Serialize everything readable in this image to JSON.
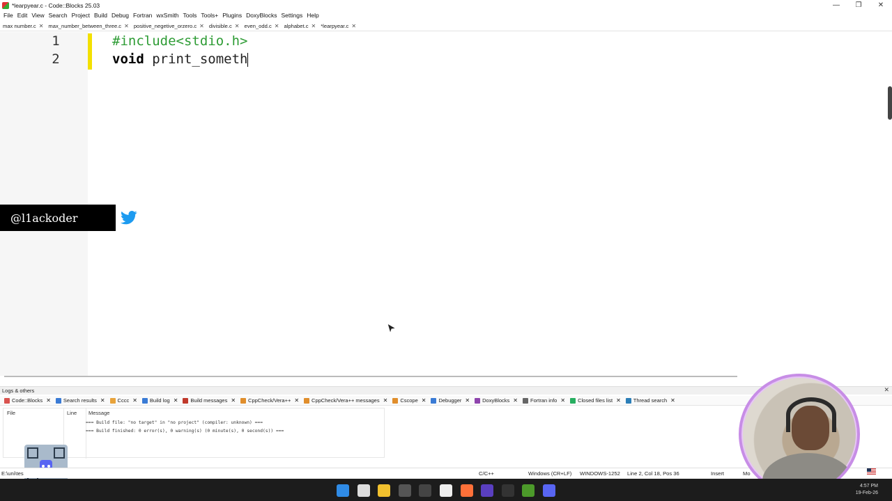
{
  "window": {
    "title": "*learpyear.c - Code::Blocks 25.03",
    "controls": [
      "—",
      "❐",
      "✕"
    ]
  },
  "menu": [
    "File",
    "Edit",
    "View",
    "Search",
    "Project",
    "Build",
    "Debug",
    "Fortran",
    "wxSmith",
    "Tools",
    "Tools+",
    "Plugins",
    "DoxyBlocks",
    "Settings",
    "Help"
  ],
  "tabs": [
    "max number.c",
    "max_number_between_three.c",
    "positive_negetive_orzero.c",
    "divisible.c",
    "even_odd.c",
    "alphabet.c",
    "*learpyear.c"
  ],
  "editor": {
    "line_numbers": [
      "1",
      "2"
    ],
    "line1": "#include<stdio.h>",
    "line2_kw": "void",
    "line2_rest": " print_someth"
  },
  "overlay": {
    "handle": "@l1ackoder",
    "icon": "twitter-bird"
  },
  "logs": {
    "title": "Logs & others",
    "tabs": [
      "Code::Blocks",
      "Search results",
      "Cccc",
      "Build log",
      "Build messages",
      "CppCheck/Vera++",
      "CppCheck/Vera++ messages",
      "Cscope",
      "Debugger",
      "DoxyBlocks",
      "Fortran info",
      "Closed files list",
      "Thread search"
    ],
    "tab_colors": [
      "#d9534f",
      "#3a7bd5",
      "#e8a33b",
      "#3a7bd5",
      "#c0392b",
      "#e08e2c",
      "#e08e2c",
      "#e08e2c",
      "#3a7bd5",
      "#8e44ad",
      "#666666",
      "#27ae60",
      "#2c7fb8"
    ],
    "columns": [
      "File",
      "Line",
      "Message"
    ],
    "messages": [
      "=== Build file: \"no target\" in \"no project\" (compiler: unknown) ===",
      "=== Build finished: 0 error(s), 0 warning(s) (0 minute(s), 0 second(s)) ==="
    ]
  },
  "status": {
    "path": "E:\\uni\\tes",
    "lang": "C/C++",
    "eol": "Windows (CR+LF)",
    "encoding": "WINDOWS-1252",
    "position": "Line 2, Col 18, Pos 36",
    "mode": "Insert",
    "extra": "Mo"
  },
  "taskbar": {
    "time": "4:57 PM",
    "date": "19-Feb-26",
    "icons": [
      "windows-start",
      "task-view",
      "file-explorer",
      "davinci",
      "calendar",
      "notion",
      "firefox",
      "obs",
      "github",
      "codeblocks",
      "discord"
    ],
    "icon_colors": [
      "#2f8be6",
      "#dddddd",
      "#f2c12e",
      "#555555",
      "#444444",
      "#eeeeee",
      "#ff7139",
      "#5a3fc0",
      "#333333",
      "#4c9a2a",
      "#5865f2"
    ]
  }
}
